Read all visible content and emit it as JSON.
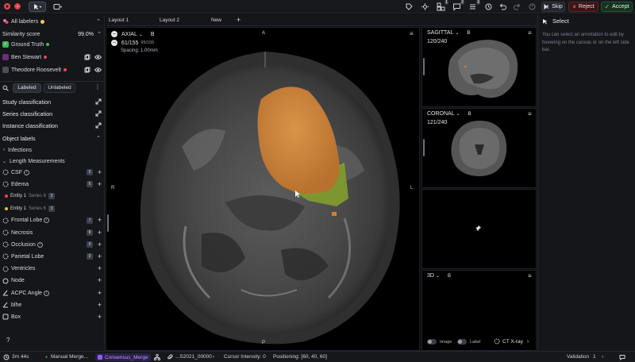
{
  "topbar": {
    "all_labelers": "All labelers",
    "skip": "Skip",
    "reject": "Reject",
    "accept": "Accept",
    "badges": [
      "1",
      "2",
      "3"
    ]
  },
  "left": {
    "similarity_label": "Similarity score",
    "similarity_value": "99.0%",
    "labelers": [
      "Ground Truth",
      "Ben Stewart",
      "Theodore Roosevelt"
    ],
    "labeled_tab": "Labeled",
    "unlabeled_tab": "Unlabeled",
    "study_classification": "Study classification",
    "series_classification": "Series classification",
    "instance_classification": "Instance classification",
    "object_labels": "Object labels",
    "groups": [
      "Infections",
      "Length Measurements"
    ],
    "items": [
      {
        "label": "CSF",
        "count": "5",
        "info": true,
        "icon": "lesion-icon"
      },
      {
        "label": "Edema",
        "count": "6",
        "info": false,
        "icon": "lesion-icon"
      },
      {
        "label": "Entity 1",
        "suffix": "Series 6",
        "count": "3",
        "color": "#e5484d",
        "entity": true
      },
      {
        "label": "Entity 1",
        "suffix": "Series 6",
        "count": "3",
        "color": "#d9c23a",
        "entity": true
      },
      {
        "label": "Frontal Lobe",
        "count": "7",
        "info": true,
        "icon": "lesion-icon"
      },
      {
        "label": "Necrosis",
        "count": "8",
        "info": false,
        "icon": "lesion-icon"
      },
      {
        "label": "Occlusion",
        "count": "9",
        "info": true,
        "icon": "lesion-icon"
      },
      {
        "label": "Parietal Lobe",
        "count": "0",
        "info": false,
        "icon": "lesion-icon"
      },
      {
        "label": "Ventricles",
        "count": "",
        "info": false,
        "icon": "lesion-icon"
      },
      {
        "label": "Node",
        "count": "",
        "info": false,
        "icon": "circle-icon"
      },
      {
        "label": "ACPC Angle",
        "count": "",
        "info": true,
        "icon": "angle-icon"
      },
      {
        "label": "blhe",
        "count": "",
        "info": false,
        "icon": "angle-icon"
      },
      {
        "label": "Box",
        "count": "",
        "info": false,
        "icon": "box-icon"
      }
    ]
  },
  "tabs": [
    "Layout 1",
    "Layout 2",
    "New"
  ],
  "axial": {
    "plane": "AXIAL",
    "series": "B",
    "slice": "61/155",
    "slice_sub": "95/155",
    "spacing": "Spacing: 1.00mm",
    "orient_top": "A",
    "orient_bottom": "P",
    "orient_left": "R",
    "orient_right": "L"
  },
  "sagittal": {
    "plane": "SAGITTAL",
    "series": "B",
    "slice": "120/240"
  },
  "coronal": {
    "plane": "CORONAL",
    "series": "B",
    "slice": "121/240"
  },
  "view3d": {
    "plane": "3D",
    "series": "B",
    "image_label": "Image",
    "label_label": "Label",
    "preset": "CT X-ray"
  },
  "right": {
    "title": "Select",
    "hint": "You can select an annotation to edit by hovering on the canvas or on the left side bar."
  },
  "status": {
    "timer": "3m 44s",
    "manual_merge": "Manual Merge...",
    "consensus": "Consensus_Merge",
    "study": "...S2021_00000",
    "cursor": "Cursor Intensity: 0",
    "positioning": "Positioning: [60, 40, 60]",
    "validation": "Validation",
    "validation_count": "1"
  },
  "colors": {
    "reject": "#e5484d",
    "accept": "#3fb950",
    "tumor": "#d98a3a",
    "edema": "#8ba536",
    "consensus": "#8b5cf6"
  }
}
